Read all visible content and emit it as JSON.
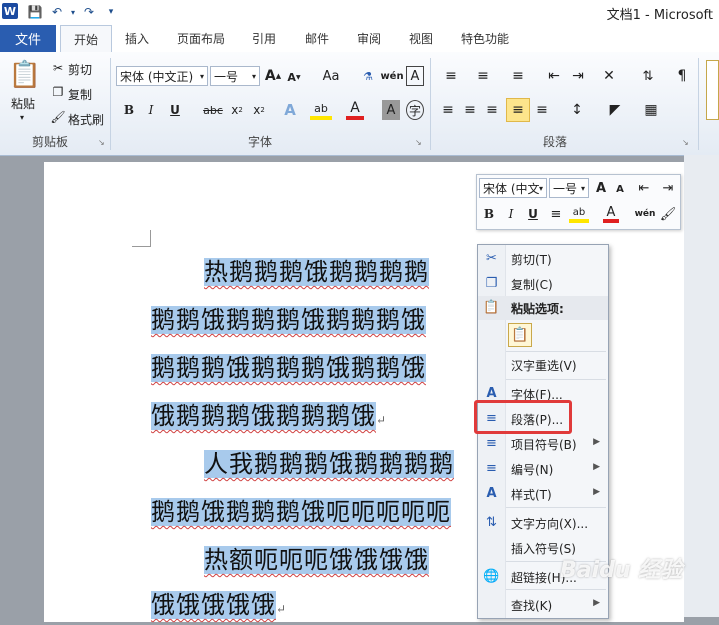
{
  "titlebar": {
    "title": "文档1 - Microsoft",
    "word_icon": "W"
  },
  "tabs": [
    "文件",
    "开始",
    "插入",
    "页面布局",
    "引用",
    "邮件",
    "审阅",
    "视图",
    "特色功能"
  ],
  "clipboard": {
    "paste": "粘贴",
    "cut": "剪切",
    "copy": "复制",
    "format_painter": "格式刷",
    "group": "剪贴板"
  },
  "font": {
    "name": "宋体 (中文正)",
    "size": "一号",
    "group": "字体"
  },
  "paragraph": {
    "group": "段落"
  },
  "mini_toolbar": {
    "font_name": "宋体 (中文",
    "font_size": "一号"
  },
  "document": {
    "lines": [
      "热鹅鹅鹅饿鹅鹅鹅鹅",
      "鹅鹅饿鹅鹅鹅饿鹅鹅鹅饿",
      "鹅鹅鹅饿鹅鹅鹅饿鹅鹅饿",
      "饿鹅鹅鹅饿鹅鹅鹅饿",
      "人我鹅鹅鹅饿鹅鹅鹅鹅",
      "鹅鹅饿鹅鹅鹅饿呃呃呃呃呃",
      "热额呃呃呃饿饿饿饿",
      "饿饿饿饿饿"
    ]
  },
  "context_menu": {
    "items": [
      "剪切(T)",
      "复制(C)",
      "粘贴选项:",
      "汉字重选(V)",
      "字体(F)...",
      "段落(P)...",
      "项目符号(B)",
      "编号(N)",
      "样式(T)",
      "文字方向(X)...",
      "插入符号(S)",
      "超链接(H)...",
      "查找(K)"
    ]
  },
  "watermark": "Baidu 经验",
  "colors": {
    "file_tab": "#2a5db0",
    "selection": "#a8caec",
    "highlight_border": "#e03a3a"
  }
}
